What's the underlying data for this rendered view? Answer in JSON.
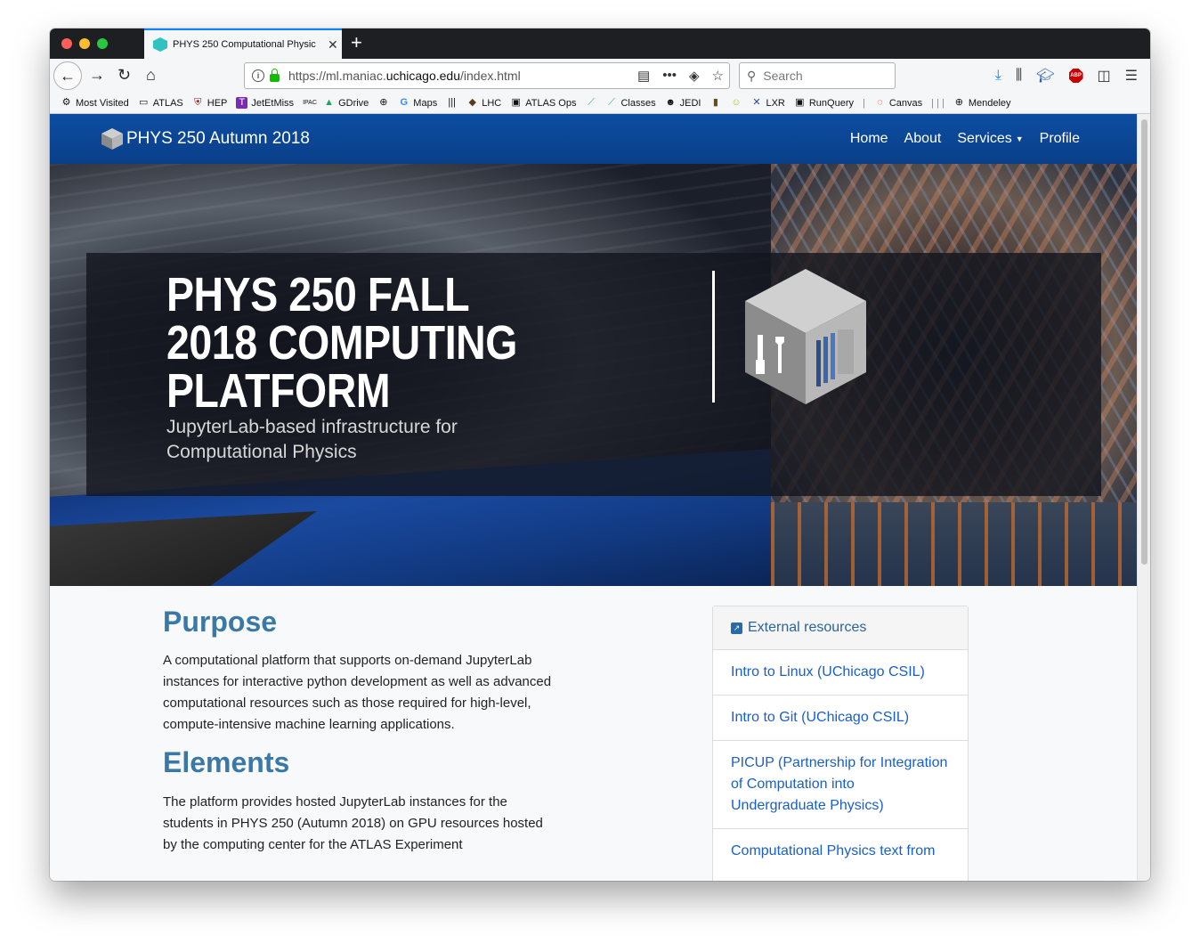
{
  "browser": {
    "tab_title": "PHYS 250 Computational Physic",
    "url_prefix": "https://ml.maniac.",
    "url_domain": "uchicago.edu",
    "url_suffix": "/index.html",
    "search_placeholder": "Search"
  },
  "bookmarks": [
    {
      "icon": "gear-icon",
      "label": "Most Visited"
    },
    {
      "icon": "folder-icon",
      "label": "ATLAS"
    },
    {
      "icon": "shield-icon",
      "label": "HEP"
    },
    {
      "icon": "t-icon",
      "label": "JetEtMiss"
    },
    {
      "icon": "ipac-icon",
      "label": ""
    },
    {
      "icon": "gdrive-icon",
      "label": "GDrive"
    },
    {
      "icon": "globe-icon",
      "label": ""
    },
    {
      "icon": "google-icon",
      "label": "Maps"
    },
    {
      "icon": "barcode-icon",
      "label": ""
    },
    {
      "icon": "turtle-icon",
      "label": "LHC"
    },
    {
      "icon": "monitor-icon",
      "label": "ATLAS Ops"
    },
    {
      "icon": "chart-icon",
      "label": ""
    },
    {
      "icon": "chart-icon",
      "label": "Classes"
    },
    {
      "icon": "panda-icon",
      "label": "JEDI"
    },
    {
      "icon": "book-icon",
      "label": ""
    },
    {
      "icon": "smiley-icon",
      "label": ""
    },
    {
      "icon": "x-icon",
      "label": "LXR"
    },
    {
      "icon": "monitor-icon",
      "label": "RunQuery"
    },
    {
      "icon": "canvas-icon",
      "label": "Canvas"
    },
    {
      "icon": "globe-icon",
      "label": "Mendeley"
    }
  ],
  "site": {
    "brand": "PHYS 250 Autumn 2018",
    "nav": {
      "home": "Home",
      "about": "About",
      "services": "Services",
      "profile": "Profile"
    },
    "hero": {
      "title": "PHYS 250 FALL 2018 COMPUTING PLATFORM",
      "subtitle": "JupyterLab-based infrastructure for Computational Physics"
    },
    "purpose": {
      "heading": "Purpose",
      "text": "A computational platform that supports on-demand JupyterLab instances for interactive python development as well as advanced computational resources such as those required for high-level, compute-intensive machine learning applications."
    },
    "elements": {
      "heading": "Elements",
      "text": "The platform provides hosted JupyterLab instances for the students in PHYS 250 (Autumn 2018) on GPU resources hosted by the computing center for the ATLAS Experiment"
    },
    "resources": {
      "heading": "External resources",
      "items": [
        "Intro to Linux (UChicago CSIL)",
        "Intro to Git (UChicago CSIL)",
        "PICUP (Partnership for Integration of Computation into Undergraduate Physics)",
        "Computational Physics text from"
      ]
    }
  },
  "colors": {
    "nav_blue": "#0c4da2",
    "heading_blue": "#3a79a6",
    "link_blue": "#1a5fc8"
  }
}
